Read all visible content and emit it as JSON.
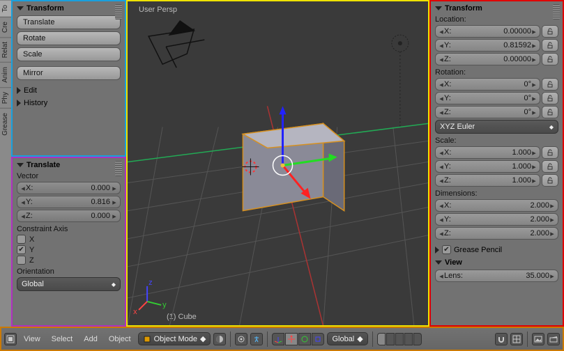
{
  "left_tabs": [
    "To",
    "Cre",
    "Relat",
    "Anim",
    "Phy",
    "Grease"
  ],
  "transform_panel": {
    "title": "Transform",
    "buttons": {
      "translate": "Translate",
      "rotate": "Rotate",
      "scale": "Scale",
      "mirror": "Mirror"
    },
    "edit": "Edit",
    "history": "History"
  },
  "translate_panel": {
    "title": "Translate",
    "vector_label": "Vector",
    "vector": {
      "x_lab": "X:",
      "x": "0.000",
      "y_lab": "Y:",
      "y": "0.816",
      "z_lab": "Z:",
      "z": "0.000"
    },
    "constraint_label": "Constraint Axis",
    "axes": {
      "x": "X",
      "y": "Y",
      "z": "Z"
    },
    "orientation_label": "Orientation",
    "orientation": "Global"
  },
  "viewport": {
    "persp": "User Persp",
    "obj": "(1) Cube"
  },
  "right": {
    "title": "Transform",
    "location_label": "Location:",
    "location": {
      "x_lab": "X:",
      "x": "0.00000",
      "y_lab": "Y:",
      "y": "0.81592",
      "z_lab": "Z:",
      "z": "0.00000"
    },
    "rotation_label": "Rotation:",
    "rotation": {
      "x_lab": "X:",
      "x": "0°",
      "y_lab": "Y:",
      "y": "0°",
      "z_lab": "Z:",
      "z": "0°"
    },
    "rot_mode": "XYZ Euler",
    "scale_label": "Scale:",
    "scale": {
      "x_lab": "X:",
      "x": "1.000",
      "y_lab": "Y:",
      "y": "1.000",
      "z_lab": "Z:",
      "z": "1.000"
    },
    "dim_label": "Dimensions:",
    "dim": {
      "x_lab": "X:",
      "x": "2.000",
      "y_lab": "Y:",
      "y": "2.000",
      "z_lab": "Z:",
      "z": "2.000"
    },
    "gp": "Grease Pencil",
    "view": "View",
    "lens_lab": "Lens:",
    "lens": "35.000"
  },
  "header": {
    "view": "View",
    "select": "Select",
    "add": "Add",
    "object": "Object",
    "mode": "Object Mode",
    "orient": "Global"
  }
}
